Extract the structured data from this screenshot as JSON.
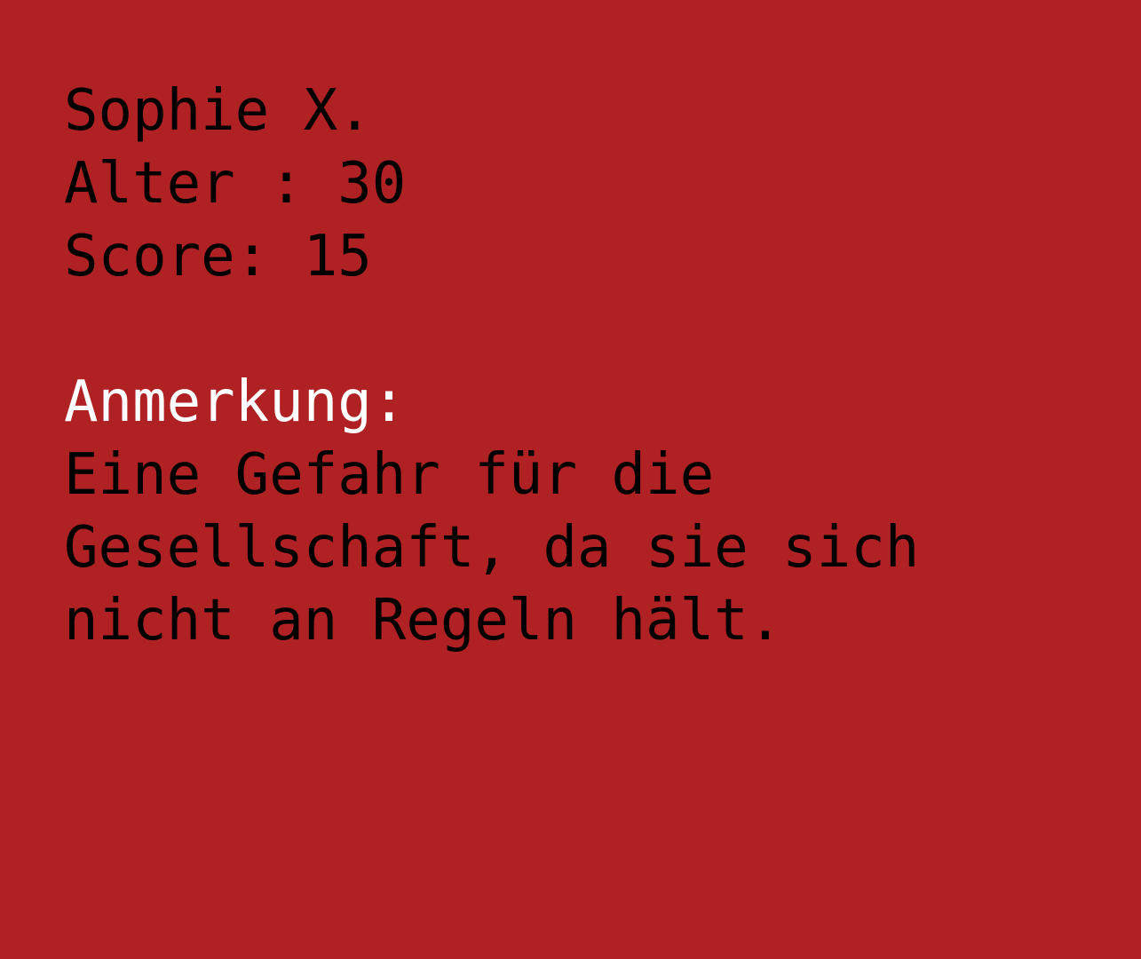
{
  "profile": {
    "name": "Sophie X.",
    "age_line": "Alter : 30",
    "score_line": "Score: 15"
  },
  "note": {
    "label": "Anmerkung:",
    "text": "Eine Gefahr für die Gesellschaft, da sie sich nicht an Regeln hält."
  },
  "colors": {
    "background": "#b02123",
    "text": "#000000",
    "label": "#ffffff"
  }
}
